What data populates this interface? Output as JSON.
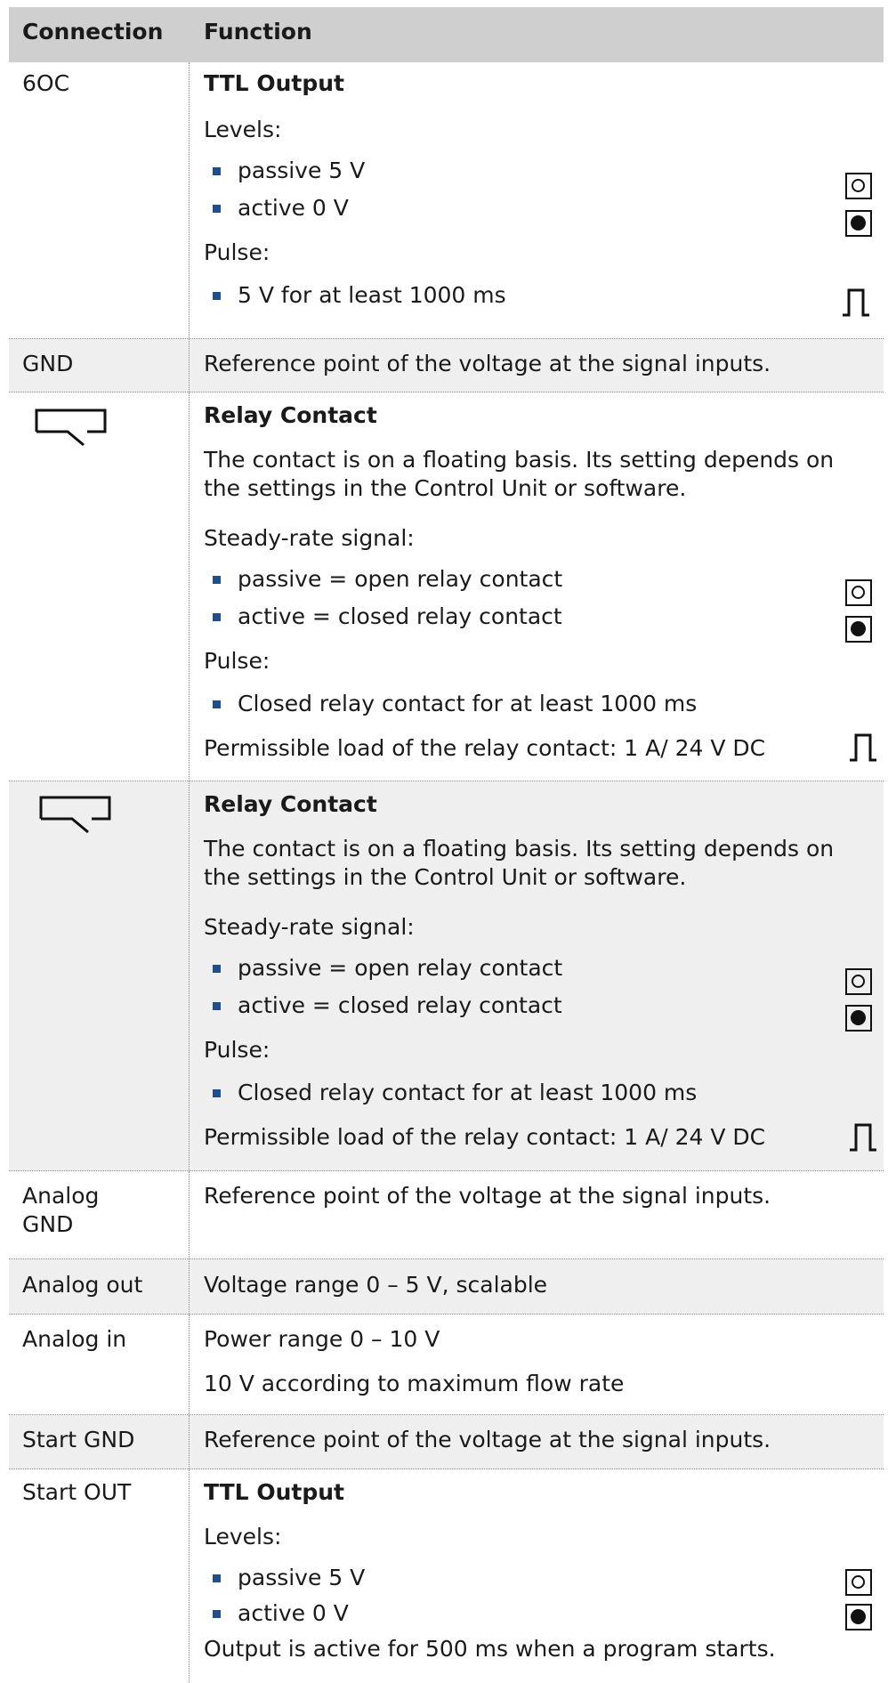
{
  "header": {
    "connection": "Connection",
    "function": "Function"
  },
  "rows": {
    "r1": {
      "connection": "6OC",
      "title": "TTL Output",
      "levels_label": "Levels:",
      "item1": "passive 5 V",
      "item2": "active 0 V",
      "pulse_label": "Pulse:",
      "item3": "5 V for at least 1000 ms",
      "icons": [
        "open-contact-icon",
        "closed-contact-icon",
        "pulse-icon"
      ]
    },
    "r2": {
      "connection": "GND",
      "text": "Reference point of the voltage at the signal inputs."
    },
    "r3": {
      "connection_icon": "relay-contact-icon",
      "title": "Relay Contact",
      "desc": "The contact is on a floating basis. Its setting depends on the settings in the Control Unit or software.",
      "steady_label": "Steady-rate signal:",
      "item1": "passive = open relay contact",
      "item2": "active = closed relay contact",
      "pulse_label": "Pulse:",
      "item3": "Closed relay contact for at least 1000 ms",
      "load": "Permissible load of the relay contact: 1 A/ 24 V DC"
    },
    "r4": {
      "connection_icon": "relay-contact-icon",
      "title": "Relay Contact",
      "desc": "The contact is on a floating basis. Its setting depends on the settings in the Control Unit or software.",
      "steady_label": "Steady-rate signal:",
      "item1": "passive = open relay contact",
      "item2": "active = closed relay contact",
      "pulse_label": "Pulse:",
      "item3": "Closed relay contact for at least 1000 ms",
      "load": "Permissible load of the relay contact: 1 A/ 24 V DC"
    },
    "r5": {
      "connection": "Analog GND",
      "text": "Reference point of the voltage at the signal inputs."
    },
    "r6": {
      "connection": "Analog out",
      "text": "Voltage range 0 – 5 V, scalable"
    },
    "r7": {
      "connection": "Analog in",
      "text1": "Power range 0 – 10 V",
      "text2": "10 V according to maximum flow rate"
    },
    "r8": {
      "connection": "Start GND",
      "text": "Reference point of the voltage at the signal inputs."
    },
    "r9": {
      "connection": "Start OUT",
      "title": "TTL Output",
      "levels_label": "Levels:",
      "item1": "passive 5 V",
      "item2": "active 0 V",
      "note": "Output is active for 500 ms when a program starts."
    }
  },
  "colors": {
    "header_bg": "#cfcfcf",
    "shaded_row_bg": "#efefef",
    "bullet": "#1f4e8c",
    "text": "#1a1a1a"
  }
}
